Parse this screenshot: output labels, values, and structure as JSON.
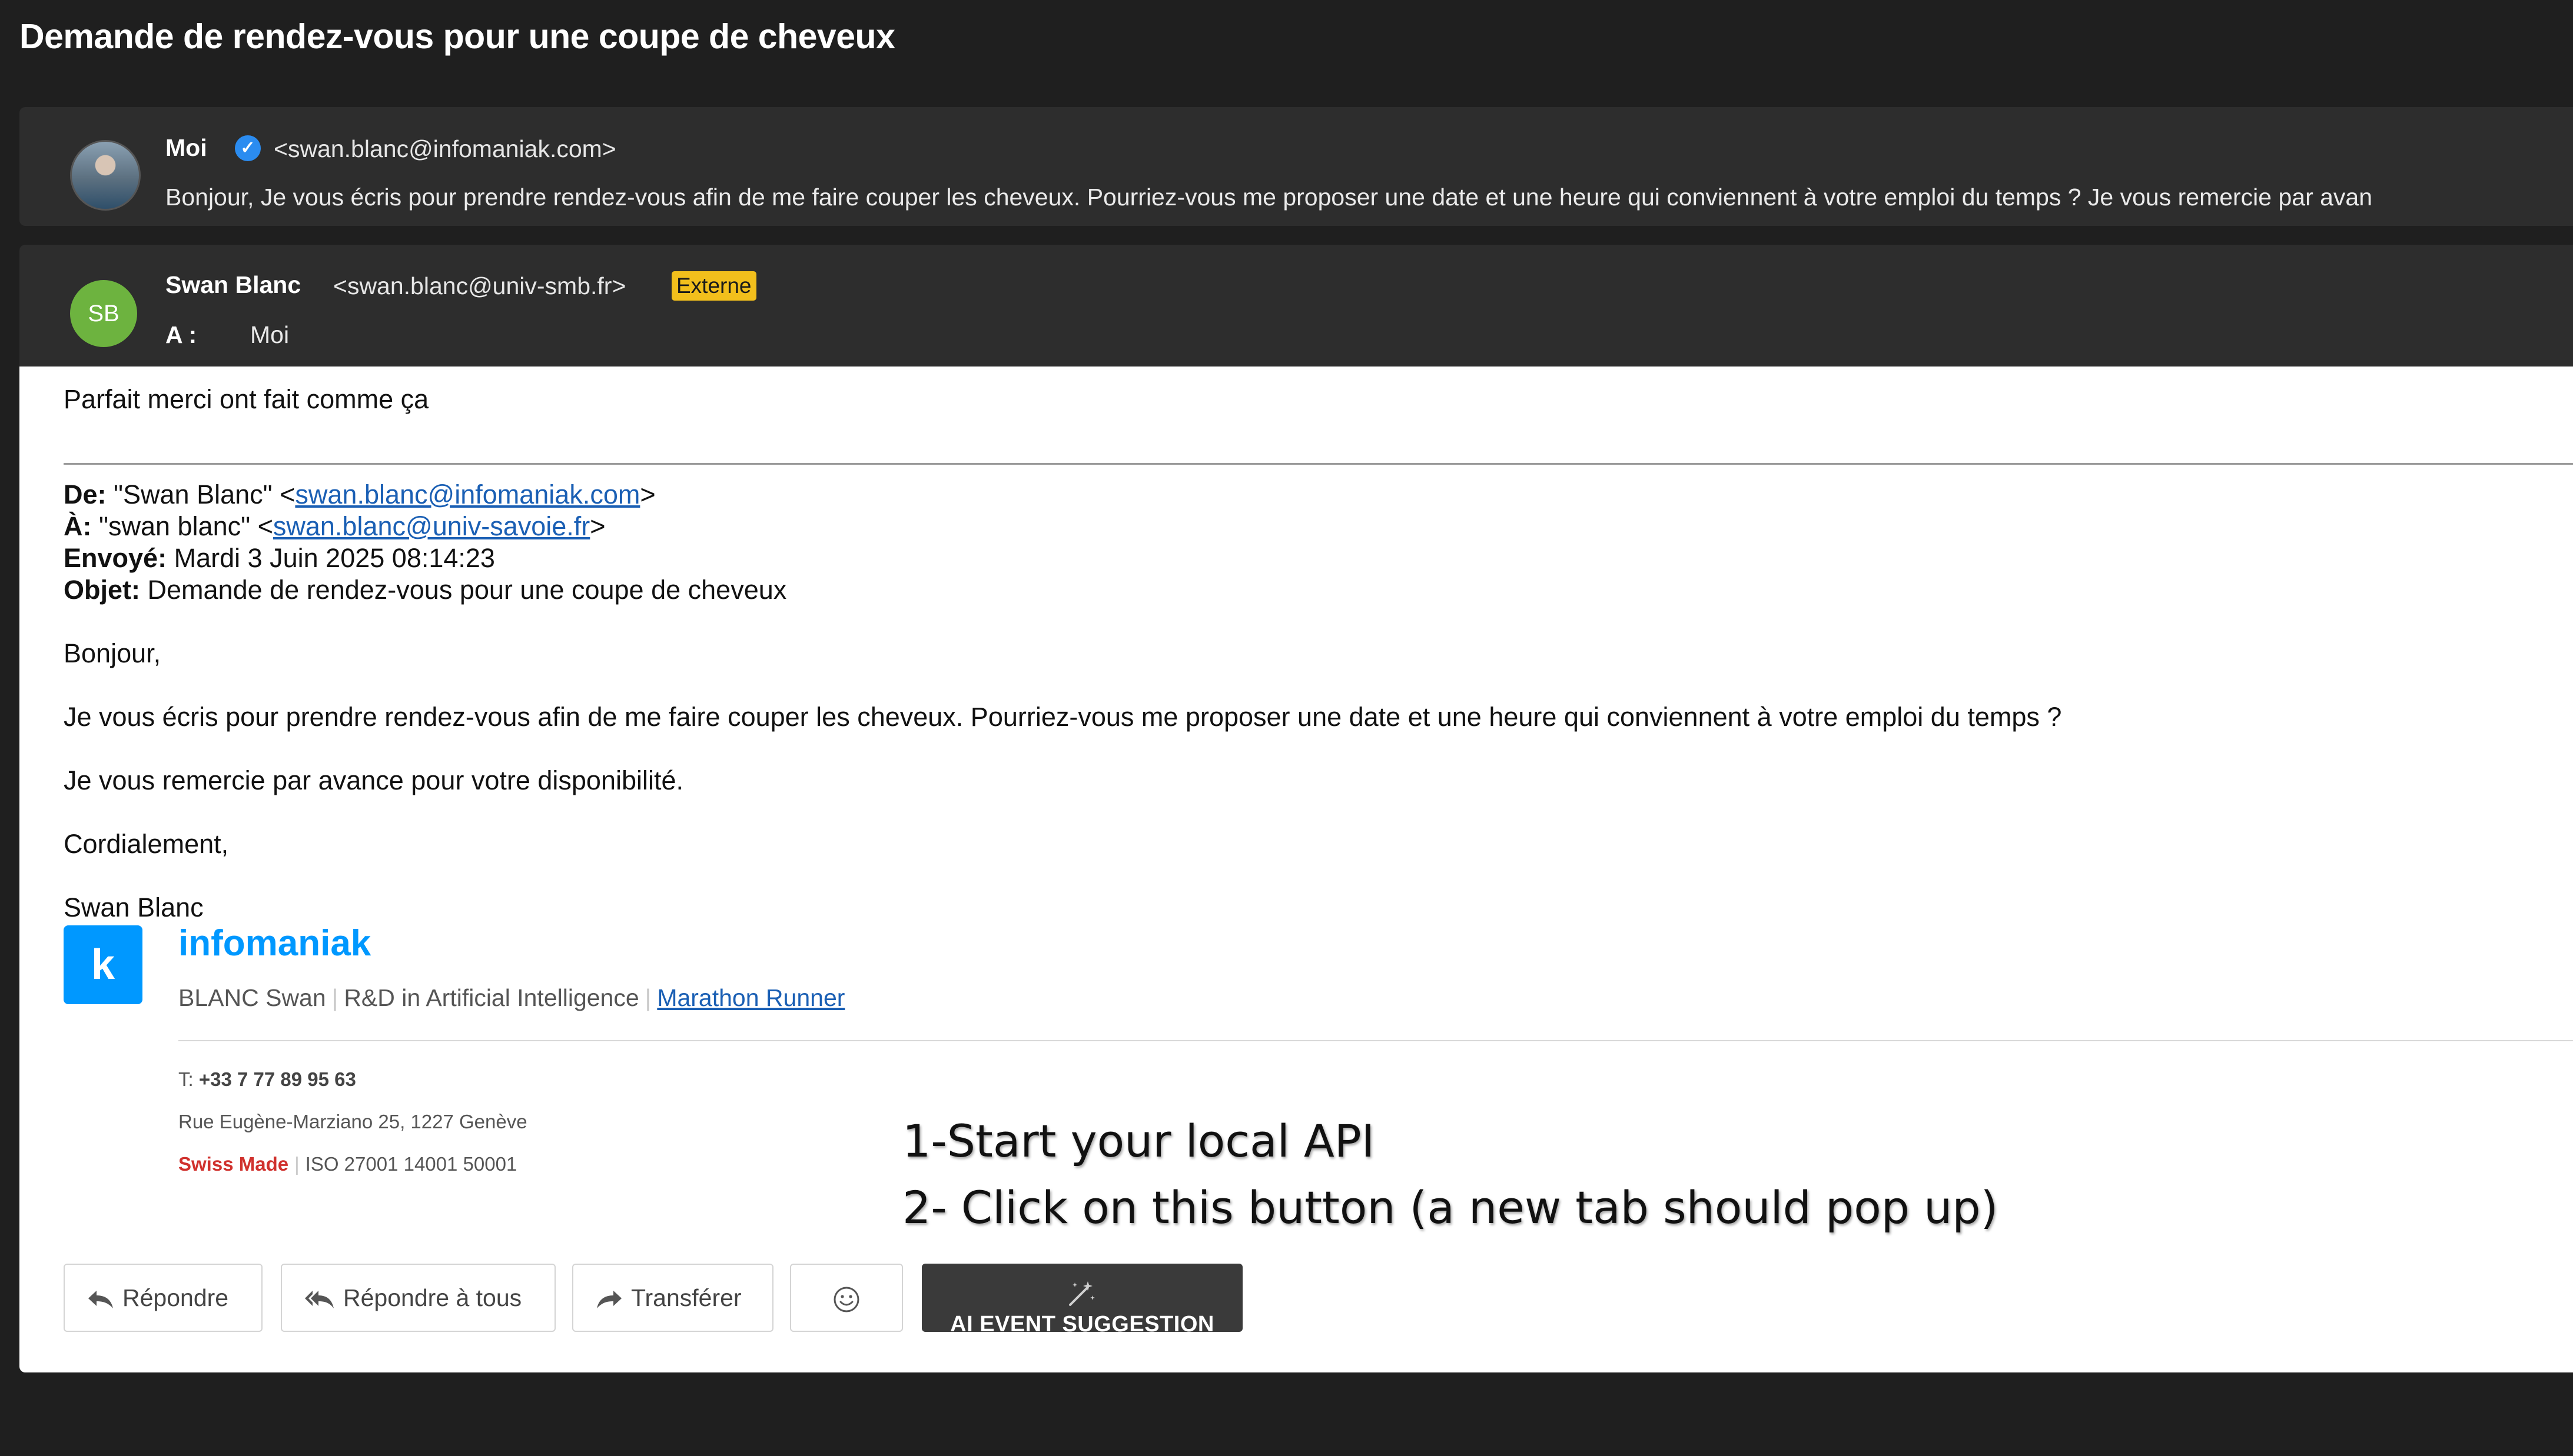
{
  "subject": "Demande de rendez-vous pour une coupe de cheveux",
  "collapsed_message": {
    "sender": "Moi",
    "email": "<swan.blanc@infomaniak.com>",
    "preview": "Bonjour, Je vous écris pour prendre rendez-vous afin de me faire couper les cheveux. Pourriez-vous me proposer une date et une heure qui conviennent à votre emploi du temps ? Je vous remercie par avan"
  },
  "open_message": {
    "initials": "SB",
    "sender": "Swan Blanc",
    "email": "<swan.blanc@univ-smb.fr>",
    "badge": "Externe",
    "to_label": "A :",
    "to_value": "Moi"
  },
  "body": {
    "reply_text": "Parfait merci ont fait comme ça",
    "quoted_header": {
      "from_label": "De:",
      "from_name": "\"Swan Blanc\" <",
      "from_email": "swan.blanc@infomaniak.com",
      "from_close": ">",
      "to_label": "À:",
      "to_name": "\"swan blanc\" <",
      "to_email": "swan.blanc@univ-savoie.fr",
      "to_close": ">",
      "sent_label": "Envoyé:",
      "sent_value": "Mardi 3 Juin 2025 08:14:23",
      "subject_label": "Objet:",
      "subject_value": "Demande de rendez-vous pour une coupe de cheveux"
    },
    "greeting": "Bonjour,",
    "paragraph1": "Je vous écris pour prendre rendez-vous afin de me faire couper les cheveux. Pourriez-vous me proposer une date et une heure qui conviennent à votre emploi du temps ?",
    "paragraph2": "Je vous remercie par avance pour votre disponibilité.",
    "closing": "Cordialement,",
    "signature_name": "Swan Blanc"
  },
  "signature": {
    "logo_letter": "k",
    "brand": "infomaniak",
    "name": "BLANC Swan",
    "role": "R&D in Artificial Intelligence",
    "link": "Marathon Runner",
    "phone_label": "T:",
    "phone": "+33 7 77 89 95 63",
    "address": "Rue Eugène-Marziano 25, 1227 Genève",
    "swiss_made": "Swiss Made",
    "iso": "ISO 27001 14001 50001"
  },
  "annotation": {
    "line1": "1-Start your local API",
    "line2": "2- Click on this button (a new tab should pop up)"
  },
  "actions": {
    "reply": "Répondre",
    "reply_all": "Répondre à tous",
    "forward": "Transférer",
    "ai_label": "AI EVENT SUGGESTION"
  },
  "colors": {
    "background": "#1f1f1f",
    "header_panel": "#2d2d2d",
    "brand_blue": "#0098ff",
    "badge_yellow": "#f2bf1c",
    "avatar_green": "#6db33f",
    "link_blue": "#1a5fb4",
    "swiss_red": "#d0312d"
  },
  "icons": {
    "verified": "verified-check-icon",
    "reply": "reply-arrow-icon",
    "reply_all": "reply-all-arrow-icon",
    "forward": "forward-arrow-icon",
    "emoji": "smiley-face-icon",
    "ai": "magic-wand-icon"
  }
}
